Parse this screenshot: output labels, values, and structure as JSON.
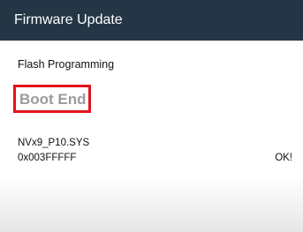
{
  "app_bar": {
    "title": "Firmware Update"
  },
  "content": {
    "section_label": "Flash Programming",
    "status": "Boot End",
    "file_name": "NVx9_P10.SYS",
    "address": "0x003FFFFF",
    "result": "OK!"
  },
  "colors": {
    "app_bar_bg": "#243645",
    "status_border": "#e3131b",
    "status_text": "#9b9b9b"
  }
}
